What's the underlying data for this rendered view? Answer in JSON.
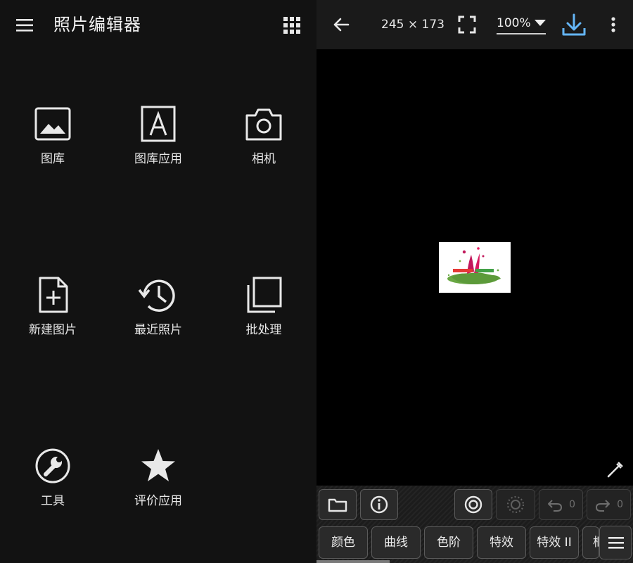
{
  "header": {
    "title": "照片编辑器"
  },
  "tiles": [
    {
      "label": "图库",
      "icon": "image-icon"
    },
    {
      "label": "图库应用",
      "icon": "letter-a-icon"
    },
    {
      "label": "相机",
      "icon": "camera-icon"
    },
    {
      "label": "新建图片",
      "icon": "new-file-icon"
    },
    {
      "label": "最近照片",
      "icon": "history-icon"
    },
    {
      "label": "批处理",
      "icon": "batch-icon"
    },
    {
      "label": "工具",
      "icon": "wrench-icon"
    },
    {
      "label": "评价应用",
      "icon": "star-icon"
    }
  ],
  "editor": {
    "dimensions": "245 × 173",
    "zoom": "100%",
    "undo_count": "0",
    "redo_count": "0",
    "tabs": [
      "颜色",
      "曲线",
      "色阶",
      "特效",
      "特效 II",
      "框"
    ]
  },
  "colors": {
    "accent": "#64b5f6",
    "panel": "#121212",
    "toolbar": "#202020"
  }
}
